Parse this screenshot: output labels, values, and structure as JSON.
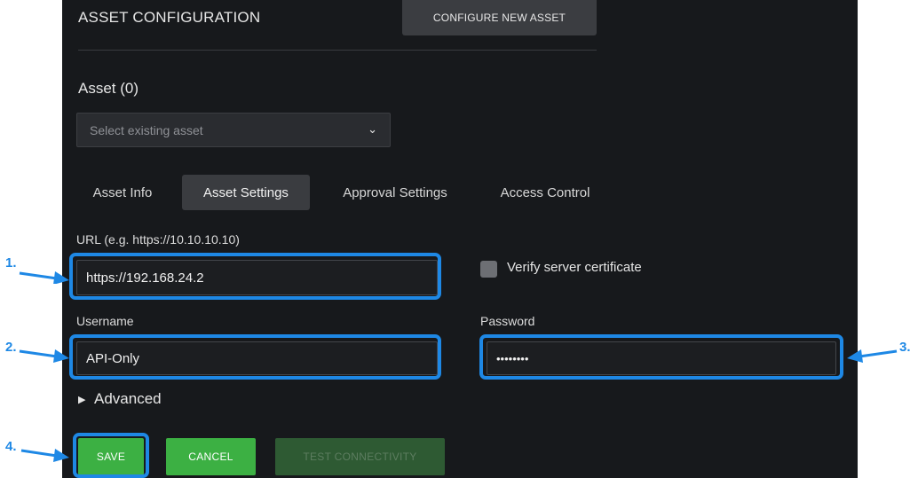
{
  "header": {
    "title": "ASSET CONFIGURATION",
    "configure_button": "CONFIGURE NEW ASSET"
  },
  "asset": {
    "heading": "Asset (0)",
    "select_placeholder": "Select existing asset"
  },
  "tabs": [
    {
      "label": "Asset Info",
      "active": false
    },
    {
      "label": "Asset Settings",
      "active": true
    },
    {
      "label": "Approval Settings",
      "active": false
    },
    {
      "label": "Access Control",
      "active": false
    }
  ],
  "form": {
    "url_label": "URL (e.g. https://10.10.10.10)",
    "url_value": "https://192.168.24.2",
    "verify_label": "Verify server certificate",
    "verify_checked": false,
    "username_label": "Username",
    "username_value": "API-Only",
    "password_label": "Password",
    "password_value": "••••••••",
    "advanced_label": "Advanced"
  },
  "buttons": {
    "save": "SAVE",
    "cancel": "CANCEL",
    "test": "TEST CONNECTIVITY"
  },
  "callouts": [
    "1.",
    "2.",
    "3.",
    "4."
  ],
  "colors": {
    "panel_bg": "#17191c",
    "highlight": "#1e88e5",
    "primary_green": "#3cb043"
  }
}
